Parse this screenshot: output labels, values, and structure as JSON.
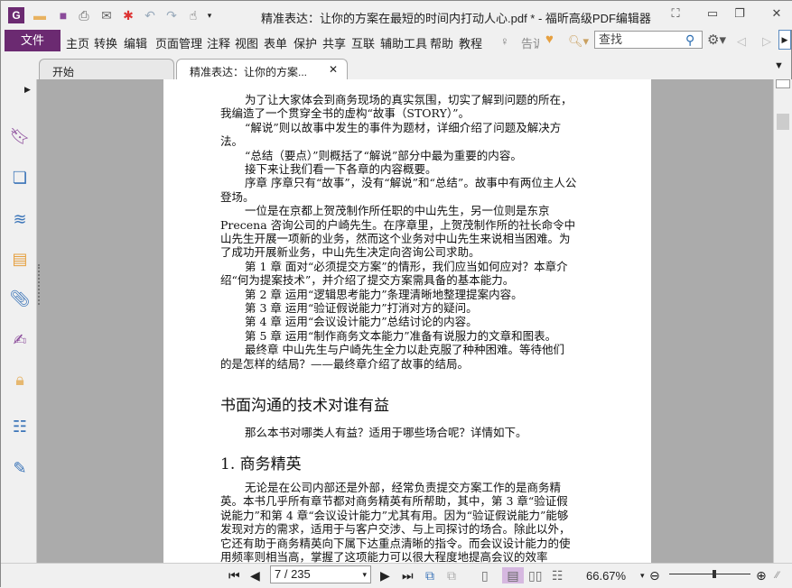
{
  "window": {
    "title": "精准表达：让你的方案在最短的时间内打动人心.pdf * - 福昕高级PDF编辑器"
  },
  "menu": {
    "file": "文件",
    "items": [
      "主页",
      "转换",
      "编辑",
      "页面管理",
      "注释",
      "视图",
      "表单",
      "保护",
      "共享",
      "互联",
      "辅助工具",
      "帮助",
      "教程"
    ],
    "tell": "告诉"
  },
  "search": {
    "placeholder": "查找"
  },
  "tabs": [
    {
      "label": "开始"
    },
    {
      "label": "精准表达：让你的方案..."
    }
  ],
  "document": {
    "lines_a": [
      {
        "t": "为了让大家体会到商务现场的真实氛围，切实了解到问题的所在，",
        "i": true
      },
      {
        "t": "我编造了一个贯穿全书的虚构“故事（STORY）”。",
        "i": false
      },
      {
        "t": "“解说”则以故事中发生的事件为题材，详细介绍了问题及解决方",
        "i": true
      },
      {
        "t": "法。",
        "i": false
      },
      {
        "t": "“总结（要点）”则概括了“解说”部分中最为重要的内容。",
        "i": true
      },
      {
        "t": "接下来让我们看一下各章的内容概要。",
        "i": true
      },
      {
        "t": "序章  序章只有“故事”，没有“解说”和“总结”。故事中有两位主人公",
        "i": true
      },
      {
        "t": "登场。",
        "i": false
      },
      {
        "t": "一位是在京都上贺茂制作所任职的中山先生，另一位则是东京",
        "i": true
      },
      {
        "t": "Precena   咨询公司的户崎先生。在序章里，上贺茂制作所的社长命令中",
        "i": false
      },
      {
        "t": "山先生开展一项新的业务，然而这个业务对中山先生来说相当困难。为",
        "i": false
      },
      {
        "t": "了成功开展新业务，中山先生决定向咨询公司求助。",
        "i": false
      },
      {
        "t": "第 1 章  面对“必须提交方案”的情形，我们应当如何应对？本章介",
        "i": true
      },
      {
        "t": "绍“何为提案技术”，并介绍了提交方案需具备的基本能力。",
        "i": false
      },
      {
        "t": "第 2 章 运用“逻辑思考能力”条理清晰地整理提案内容。",
        "i": true
      },
      {
        "t": "第 3 章 运用“验证假说能力”打消对方的疑问。",
        "i": true
      },
      {
        "t": "第 4 章 运用“会议设计能力”总结讨论的内容。",
        "i": true
      },
      {
        "t": "第 5 章 运用“制作商务文本能力”准备有说服力的文章和图表。",
        "i": true
      },
      {
        "t": "最终章    中山先生与户崎先生全力以赴克服了种种困难。等待他们",
        "i": true
      },
      {
        "t": "的是怎样的结局？——最终章介绍了故事的结局。",
        "i": false
      }
    ],
    "heading1": "书面沟通的技术对谁有益",
    "intro": "那么本书对哪类人有益？适用于哪些场合呢？详情如下。",
    "heading2": "1. 商务精英",
    "lines_b": [
      {
        "t": "无论是在公司内部还是外部，经常负责提交方案工作的是商务精",
        "i": true
      },
      {
        "t": "英。本书几乎所有章节都对商务精英有所帮助，其中，第 3 章“验证假",
        "i": false
      },
      {
        "t": "说能力”和第 4 章“会议设计能力”尤其有用。因为“验证假说能力”能够",
        "i": false
      },
      {
        "t": "发现对方的需求，适用于与客户交涉、与上司探讨的场合。除此以外，",
        "i": false
      },
      {
        "t": "它还有助于商务精英向下属下达重点清晰的指令。而会议设计能力的使",
        "i": false
      },
      {
        "t": "用频率则相当高，掌握了这项能力可以很大程度地提高会议的效率",
        "i": false
      }
    ]
  },
  "status": {
    "page": "7 / 235",
    "zoom": "66.67%",
    "zoom_level": 0.55
  },
  "colors": {
    "brand": "#6b2a71",
    "accent": "#3a74b8"
  }
}
